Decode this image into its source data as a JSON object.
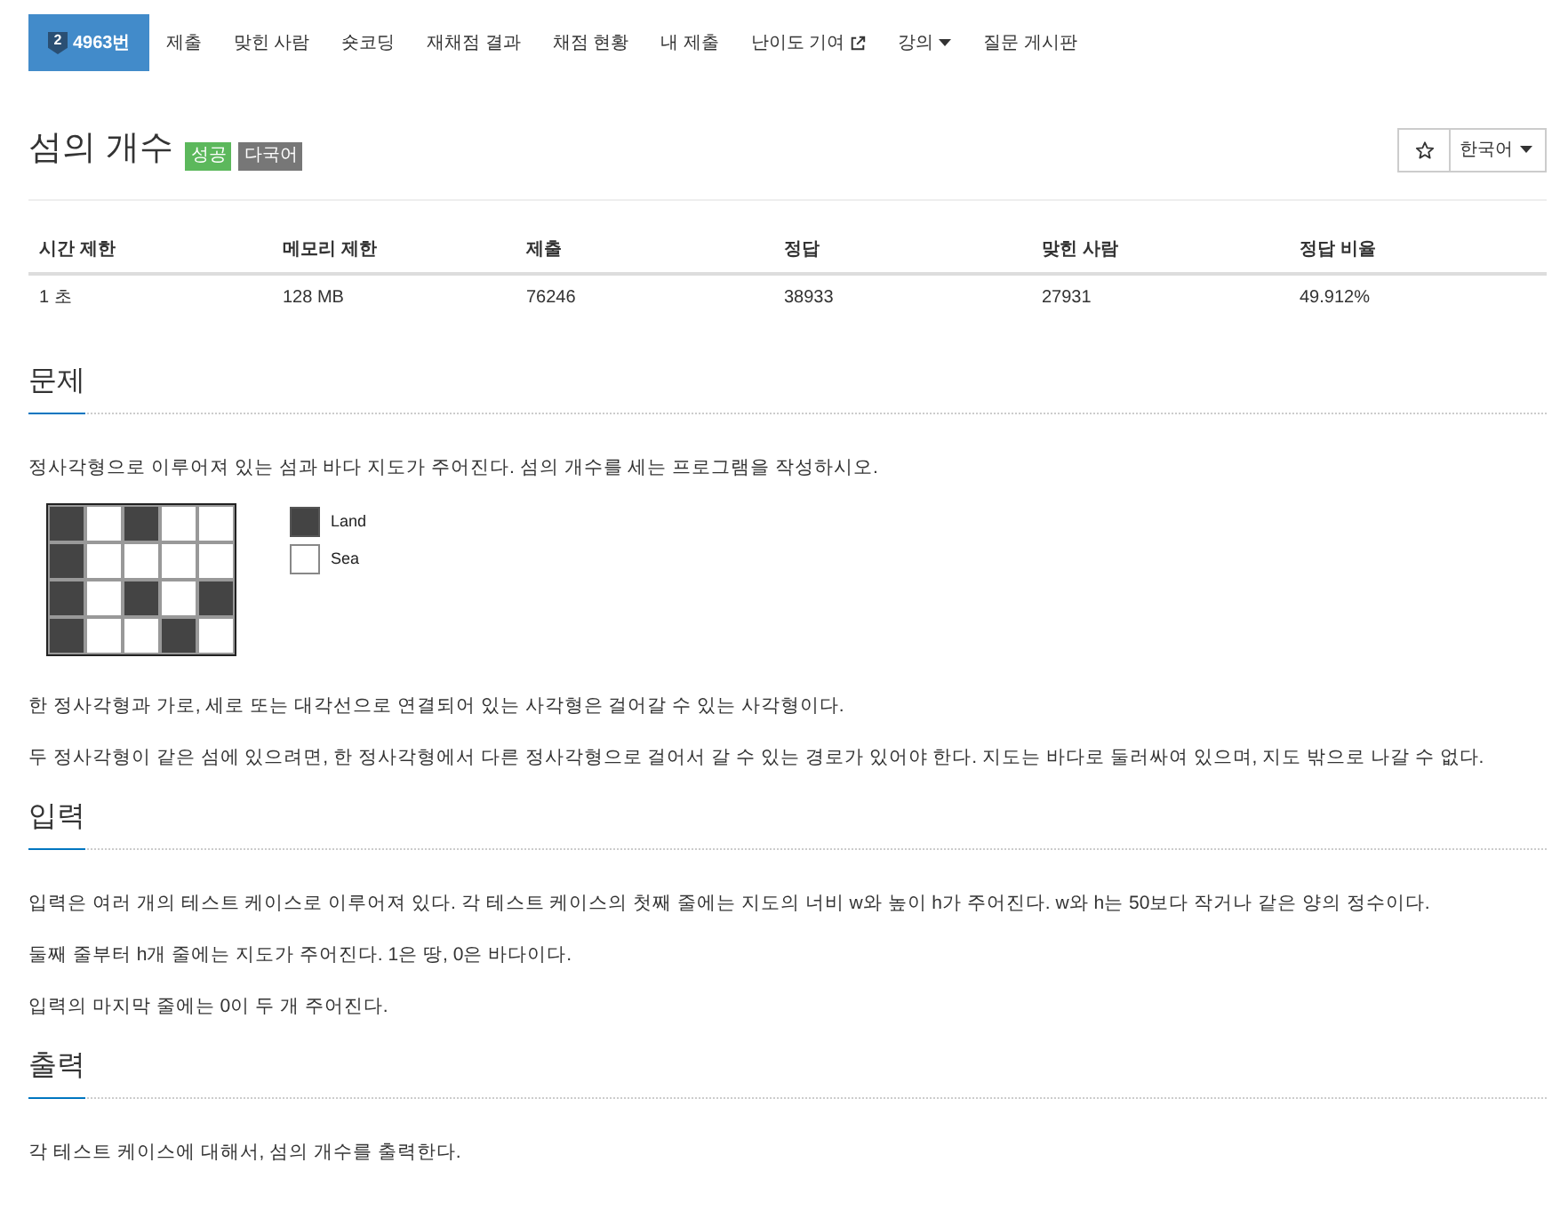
{
  "nav": {
    "items": [
      {
        "label": "4963번",
        "tier": "2",
        "kind": "problem",
        "selected": true
      },
      {
        "label": "제출",
        "kind": "plain",
        "selected": false
      },
      {
        "label": "맞힌 사람",
        "kind": "plain",
        "selected": false
      },
      {
        "label": "숏코딩",
        "kind": "plain",
        "selected": false
      },
      {
        "label": "재채점 결과",
        "kind": "plain",
        "selected": false
      },
      {
        "label": "채점 현황",
        "kind": "plain",
        "selected": false
      },
      {
        "label": "내 제출",
        "kind": "plain",
        "selected": false
      },
      {
        "label": "난이도 기여",
        "kind": "external",
        "selected": false
      },
      {
        "label": "강의",
        "kind": "dropdown",
        "selected": false
      },
      {
        "label": "질문 게시판",
        "kind": "plain",
        "selected": false
      }
    ]
  },
  "problem": {
    "title": "섬의 개수",
    "labels": [
      {
        "text": "성공",
        "color": "#5cb85c"
      },
      {
        "text": "다국어",
        "color": "#777777"
      }
    ],
    "language": "한국어"
  },
  "info_table": {
    "columns": [
      "시간 제한",
      "메모리 제한",
      "제출",
      "정답",
      "맞힌 사람",
      "정답 비율"
    ],
    "rows": [
      [
        "1 초",
        "128 MB",
        "76246",
        "38933",
        "27931",
        "49.912%"
      ]
    ]
  },
  "sections": [
    {
      "heading": "문제",
      "blocks": [
        {
          "kind": "text",
          "text": "정사각형으로 이루어져 있는 섬과 바다 지도가 주어진다. 섬의 개수를 세는 프로그램을 작성하시오."
        },
        {
          "kind": "figure",
          "map": [
            [
              true,
              false,
              true,
              false,
              false
            ],
            [
              true,
              false,
              false,
              false,
              false
            ],
            [
              true,
              false,
              true,
              false,
              true
            ],
            [
              true,
              false,
              false,
              true,
              false
            ]
          ],
          "legend": [
            {
              "label": "Land",
              "land": true
            },
            {
              "label": "Sea",
              "land": false
            }
          ]
        },
        {
          "kind": "text",
          "text": "한 정사각형과 가로, 세로 또는 대각선으로 연결되어 있는 사각형은 걸어갈 수 있는 사각형이다."
        },
        {
          "kind": "text",
          "text": "두 정사각형이 같은 섬에 있으려면, 한 정사각형에서 다른 정사각형으로 걸어서 갈 수 있는 경로가 있어야 한다. 지도는 바다로 둘러싸여 있으며, 지도 밖으로 나갈 수 없다."
        }
      ]
    },
    {
      "heading": "입력",
      "blocks": [
        {
          "kind": "text",
          "text": "입력은 여러 개의 테스트 케이스로 이루어져 있다. 각 테스트 케이스의 첫째 줄에는 지도의 너비 w와 높이 h가 주어진다. w와 h는 50보다 작거나 같은 양의 정수이다."
        },
        {
          "kind": "text",
          "text": "둘째 줄부터 h개 줄에는 지도가 주어진다. 1은 땅, 0은 바다이다."
        },
        {
          "kind": "text",
          "text": "입력의 마지막 줄에는 0이 두 개 주어진다."
        }
      ]
    },
    {
      "heading": "출력",
      "blocks": [
        {
          "kind": "text",
          "text": "각 테스트 케이스에 대해서, 섬의 개수를 출력한다."
        }
      ]
    }
  ]
}
